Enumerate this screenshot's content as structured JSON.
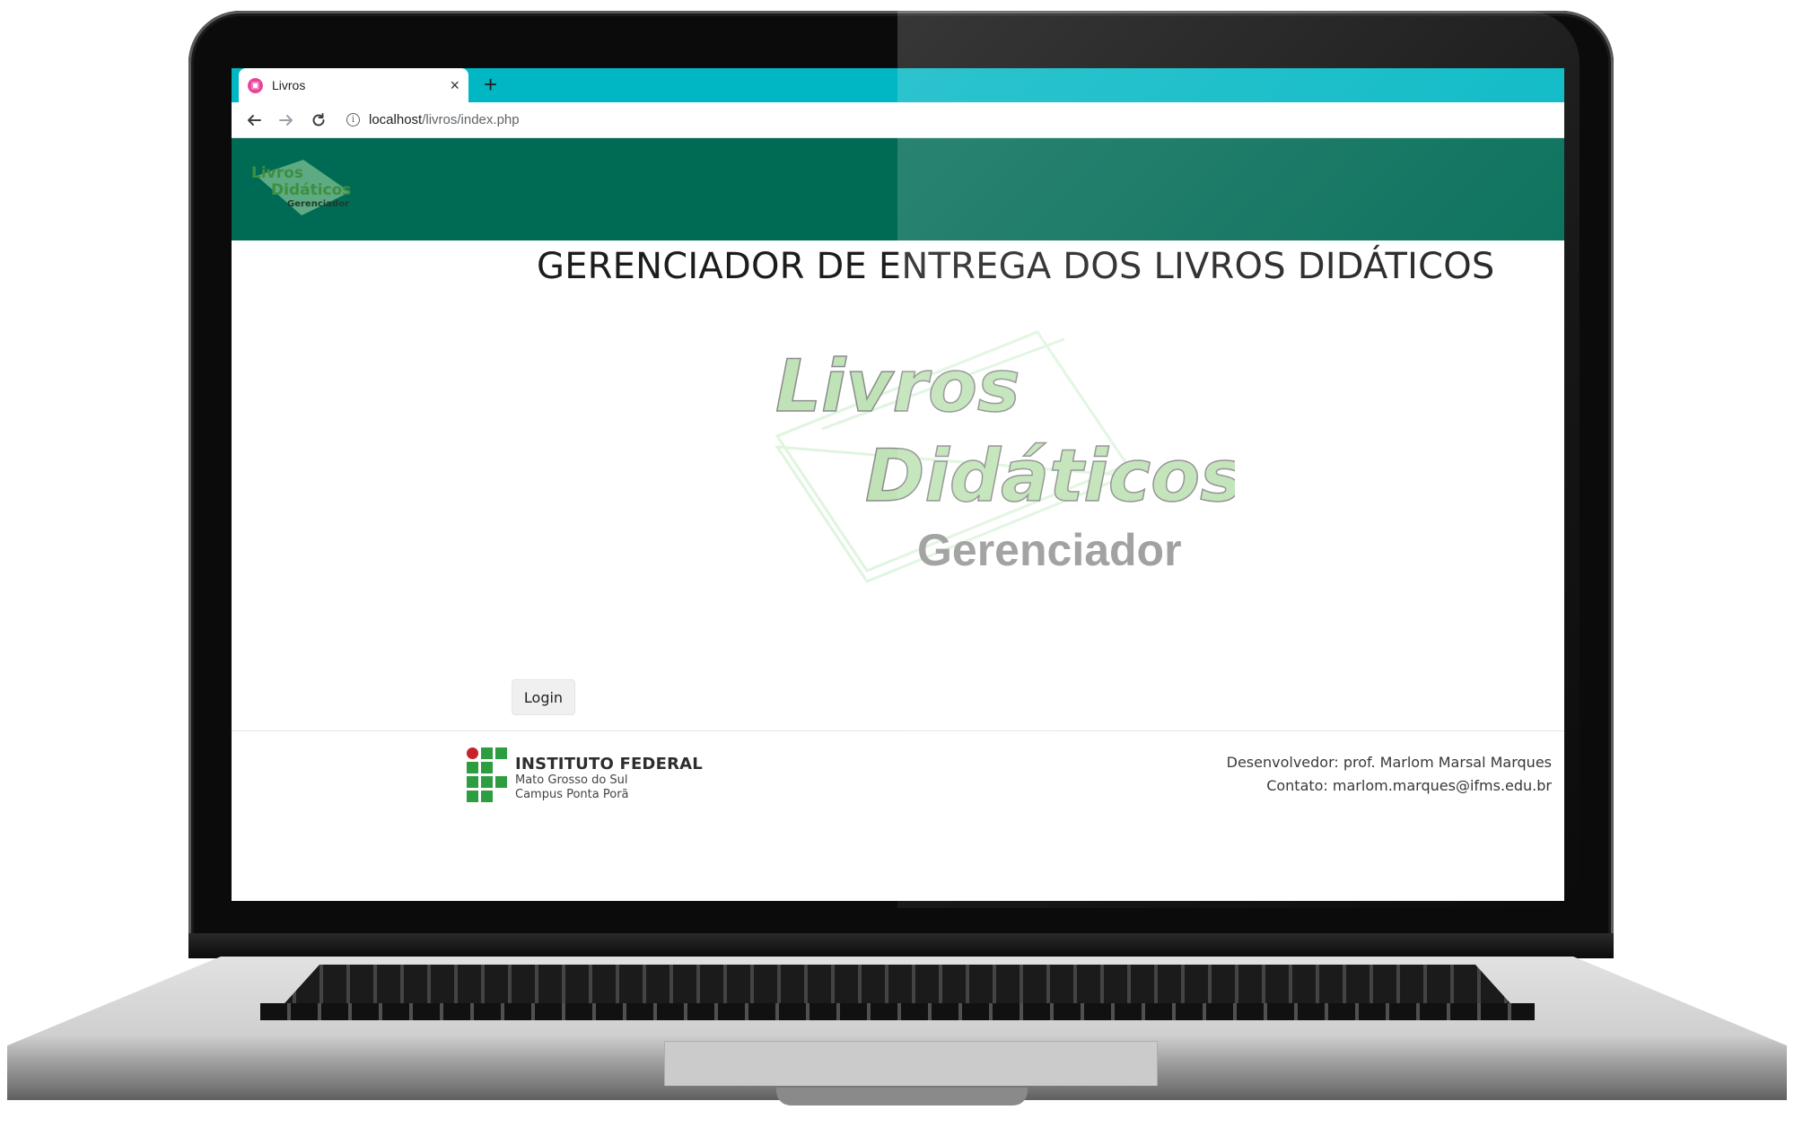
{
  "browser": {
    "tab_title": "Livros",
    "new_tab_symbol": "+",
    "close_symbol": "×",
    "url_host": "localhost",
    "url_path": "/livros/index.php"
  },
  "header": {
    "brand_line1": "Livros",
    "brand_line2": "Didáticos",
    "brand_line3": "Gerenciador"
  },
  "main": {
    "title": "GERENCIADOR DE ENTREGA DOS LIVROS DIDÁTICOS",
    "hero_line1": "Livros",
    "hero_line2": "Didáticos",
    "hero_line3": "Gerenciador",
    "login_label": "Login"
  },
  "footer": {
    "institute_name": "INSTITUTO FEDERAL",
    "institute_state": "Mato Grosso do Sul",
    "institute_campus": "Campus Ponta Porã",
    "developer": "Desenvolvedor: prof. Marlom Marsal Marques",
    "contact": "Contato: marlom.marques@ifms.edu.br"
  },
  "colors": {
    "tab_strip": "#00b7c3",
    "header_bg": "#006b55",
    "logo_green": "#8fcf8f",
    "institute_green": "#2e9d3f",
    "institute_red": "#c8232c"
  }
}
